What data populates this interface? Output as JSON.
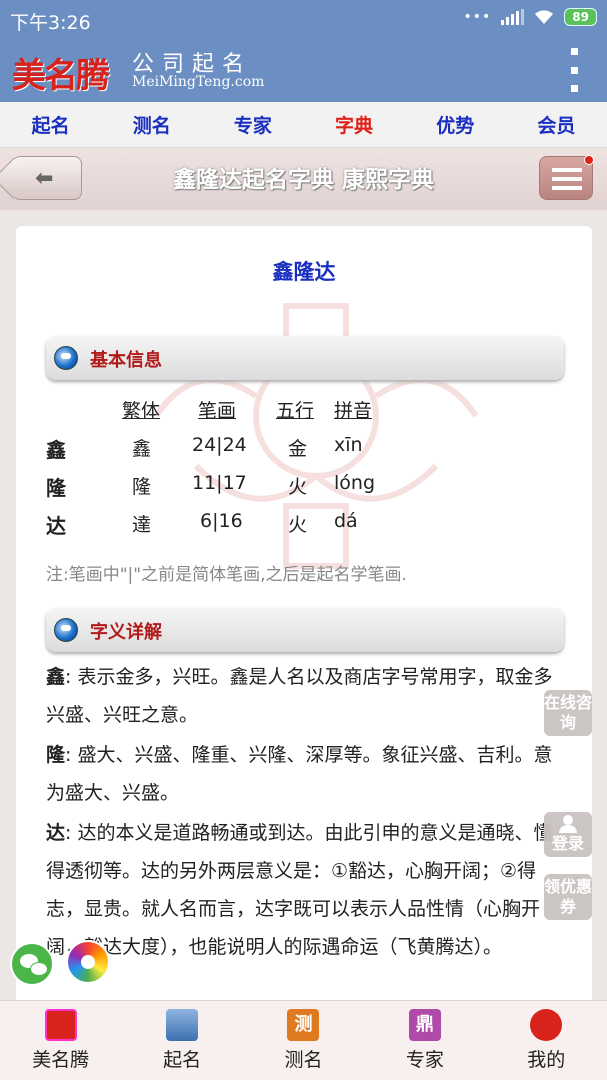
{
  "status": {
    "time": "下午3:26",
    "dots": "•••",
    "battery": "89"
  },
  "header": {
    "brand_cn": "美名腾",
    "brand_sub": "公司起名",
    "brand_url": "MeiMingTeng.com"
  },
  "topnav": [
    "起名",
    "测名",
    "专家",
    "字典",
    "优势",
    "会员"
  ],
  "titlebar": {
    "title": "鑫隆达起名字典 康熙字典",
    "back": "⬅"
  },
  "word": "鑫隆达",
  "basic": {
    "heading": "基本信息",
    "columns": [
      "繁体",
      "笔画",
      "五行",
      "拼音"
    ],
    "rows": [
      {
        "char": "鑫",
        "trad": "鑫",
        "strokes": "24|24",
        "wuxing": "金",
        "pinyin": "xīn"
      },
      {
        "char": "隆",
        "trad": "隆",
        "strokes": "11|17",
        "wuxing": "火",
        "pinyin": "lóng"
      },
      {
        "char": "达",
        "trad": "達",
        "strokes": "6|16",
        "wuxing": "火",
        "pinyin": "dá"
      }
    ],
    "note": "注:笔画中\"|\"之前是简体笔画,之后是起名学笔画."
  },
  "meaning": {
    "heading": "字义详解",
    "items": [
      {
        "char": "鑫",
        "text": ": 表示金多，兴旺。鑫是人名以及商店字号常用字，取金多兴盛、兴旺之意。"
      },
      {
        "char": "隆",
        "text": ": 盛大、兴盛、隆重、兴隆、深厚等。象征兴盛、吉利。意为盛大、兴盛。"
      },
      {
        "char": "达",
        "text": ": 达的本义是道路畅通或到达。由此引申的意义是通晓、懂得透彻等。达的另外两层意义是：①豁达，心胸开阔；②得志，显贵。就人名而言，达字既可以表示人品性情（心胸开阔，豁达大度），也能说明人的际遇命运（飞黄腾达）。"
      }
    ]
  },
  "float": {
    "consult": "在线咨询",
    "login": "登录",
    "coupon": "领优惠券"
  },
  "bottomnav": [
    {
      "label": "美名腾",
      "icon": "brand-icon",
      "glyph": "",
      "color": "#d8231c"
    },
    {
      "label": "起名",
      "icon": "book-icon",
      "glyph": "",
      "color": "#3d6fb0"
    },
    {
      "label": "测名",
      "icon": "test-icon",
      "glyph": "测",
      "color": "#e07a20"
    },
    {
      "label": "专家",
      "icon": "expert-icon",
      "glyph": "鼎",
      "color": "#b04aa8"
    },
    {
      "label": "我的",
      "icon": "user-icon",
      "glyph": "",
      "color": "#d8231c"
    }
  ]
}
